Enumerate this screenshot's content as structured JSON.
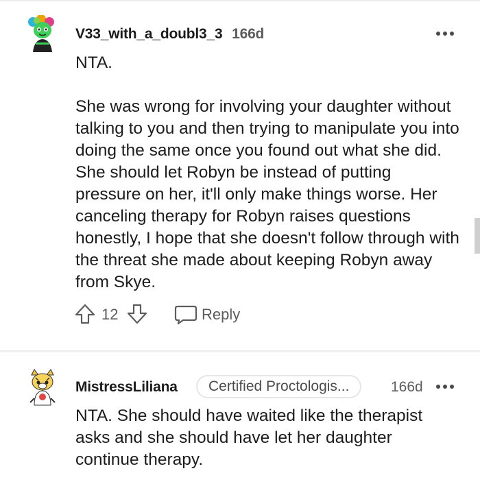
{
  "comments": [
    {
      "username": "V33_with_a_doubl3_3",
      "age": "166d",
      "paragraphs": [
        "NTA.",
        "She was wrong for involving your daughter without talking to you and then trying to manipulate you into doing the same once you found out what she did. She should let Robyn be instead of putting pressure on her, it'll only make things worse. Her canceling therapy for Robyn raises questions honestly, I hope that she doesn't follow through with the threat she made about keeping Robyn away from Skye."
      ],
      "votes": "12",
      "reply_label": "Reply"
    },
    {
      "username": "MistressLiliana",
      "flair": "Certified Proctologis...",
      "age": "166d",
      "paragraphs": [
        "NTA. She should have waited like the therapist asks and she should have let her daughter continue therapy."
      ]
    }
  ],
  "icons": {
    "upvote": "arrow-up-outline-icon",
    "downvote": "arrow-down-outline-icon",
    "reply": "speech-bubble-icon",
    "more": "three-dots-icon"
  },
  "colors": {
    "text": "#1c1c1c",
    "muted": "#5c5c5c",
    "divider": "#efefef"
  }
}
